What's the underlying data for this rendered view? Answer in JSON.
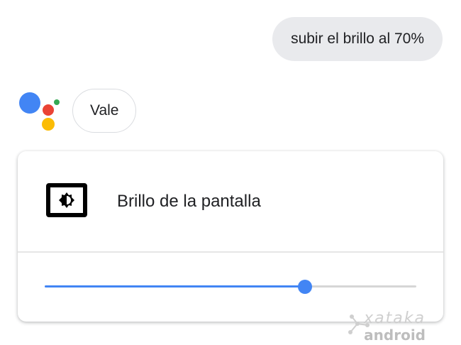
{
  "colors": {
    "blue": "#4285F4",
    "red": "#EA4335",
    "yellow": "#FBBC05",
    "green": "#34A853"
  },
  "conversation": {
    "user_message": "subir el brillo al 70%",
    "assistant_reply": "Vale"
  },
  "assistant_logo_icon": "google-assistant-dots-icon",
  "card": {
    "title": "Brillo de la pantalla",
    "icon": "brightness-icon",
    "slider": {
      "value_fraction": 0.7
    }
  },
  "watermark": {
    "brand": "xataka",
    "sub": "android"
  }
}
